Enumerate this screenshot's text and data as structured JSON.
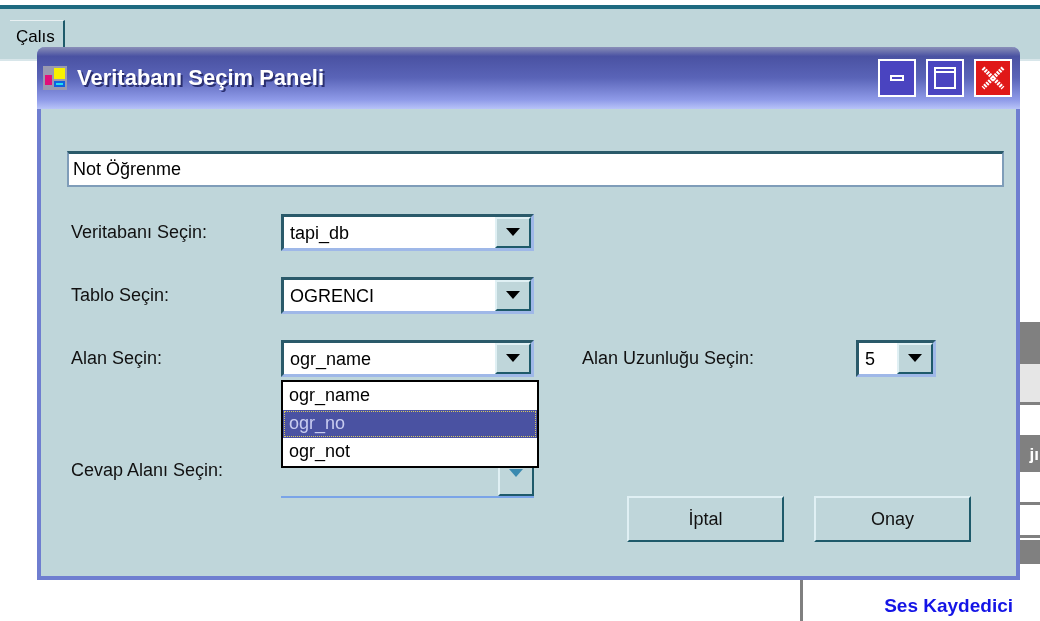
{
  "background": {
    "tab": "Çalıs",
    "fragment": "jı",
    "panel_title": "Ses Kaydedici"
  },
  "dialog": {
    "title": "Veritabanı Seçim Paneli",
    "name_field": {
      "value": "Not Öğrenme"
    },
    "fields": [
      {
        "label": "Veritabanı Seçin:",
        "value": "tapi_db",
        "disabled": false
      },
      {
        "label": "Tablo Seçin:",
        "value": "OGRENCI",
        "disabled": false
      },
      {
        "label": "Alan Seçin:",
        "value": "ogr_name",
        "disabled": false
      },
      {
        "label": "Cevap Alanı Seçin:",
        "disabled": true
      }
    ],
    "dropdown": {
      "options": [
        {
          "label": "ogr_name",
          "selected": false
        },
        {
          "label": "ogr_no",
          "selected": true
        },
        {
          "label": "ogr_not",
          "selected": false
        }
      ]
    },
    "length": {
      "label": "Alan Uzunluğu Seçin:",
      "value": "5"
    },
    "buttons": [
      "İptal",
      "Onay"
    ]
  }
}
